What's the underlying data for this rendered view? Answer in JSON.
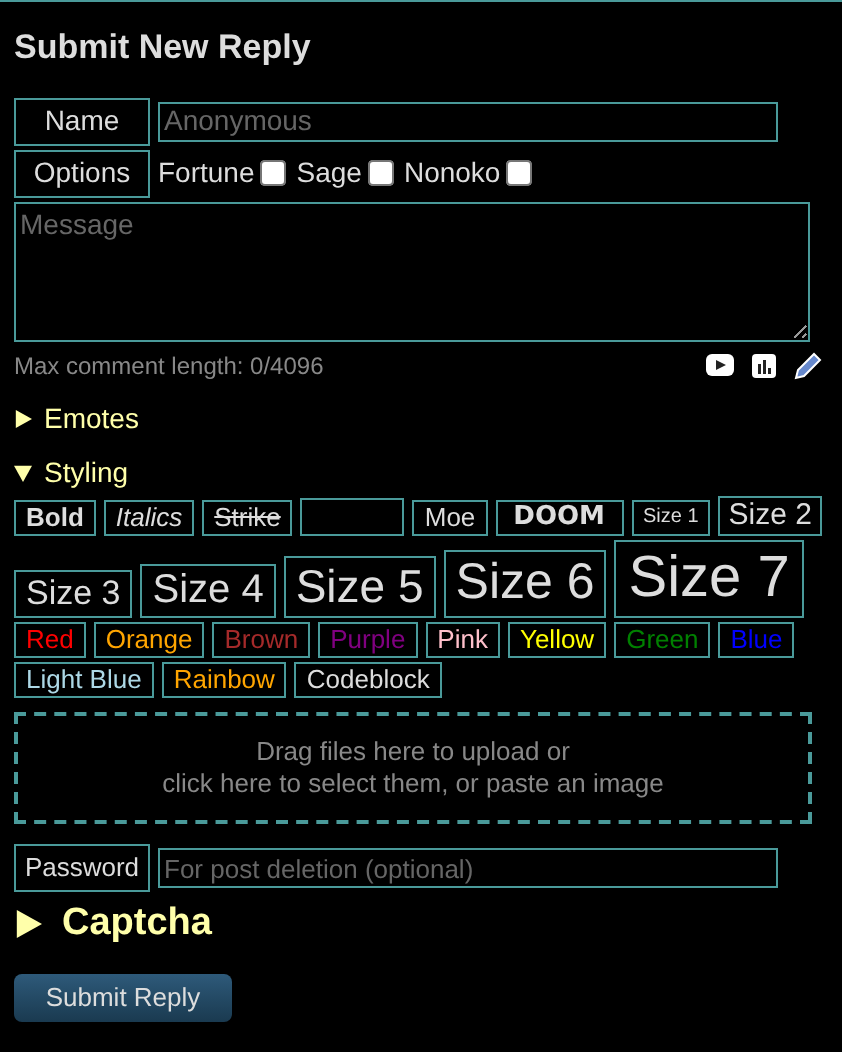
{
  "title": "Submit New Reply",
  "name_field": {
    "label": "Name",
    "placeholder": "Anonymous"
  },
  "options": {
    "label": "Options",
    "items": [
      {
        "label": "Fortune",
        "checked": false
      },
      {
        "label": "Sage",
        "checked": false
      },
      {
        "label": "Nonoko",
        "checked": false
      }
    ]
  },
  "message": {
    "placeholder": "Message",
    "counter": "Max comment length: 0/4096"
  },
  "emotes": {
    "label": "Emotes",
    "expanded": false
  },
  "styling": {
    "label": "Styling",
    "expanded": true,
    "buttons": [
      {
        "kind": "bold",
        "label": "Bold"
      },
      {
        "kind": "italic",
        "label": "Italics"
      },
      {
        "kind": "strike",
        "label": "Strike"
      },
      {
        "kind": "spoiler"
      },
      {
        "kind": "moe",
        "label": "Moe"
      },
      {
        "kind": "doom",
        "label": "DOOM"
      },
      {
        "kind": "size1",
        "label": "Size 1"
      },
      {
        "kind": "size2",
        "label": "Size 2"
      },
      {
        "kind": "size3",
        "label": "Size 3"
      },
      {
        "kind": "size4",
        "label": "Size 4"
      },
      {
        "kind": "size5",
        "label": "Size 5"
      },
      {
        "kind": "size6",
        "label": "Size 6"
      },
      {
        "kind": "size7",
        "label": "Size 7"
      },
      {
        "kind": "color",
        "label": "Red",
        "color": "#ff0000"
      },
      {
        "kind": "color",
        "label": "Orange",
        "color": "#ffa500"
      },
      {
        "kind": "color",
        "label": "Brown",
        "color": "#a52a2a"
      },
      {
        "kind": "color",
        "label": "Purple",
        "color": "#800080"
      },
      {
        "kind": "color",
        "label": "Pink",
        "color": "#ffc0cb"
      },
      {
        "kind": "color",
        "label": "Yellow",
        "color": "#ffff00"
      },
      {
        "kind": "color",
        "label": "Green",
        "color": "#008000"
      },
      {
        "kind": "color",
        "label": "Blue",
        "color": "#0000ff"
      },
      {
        "kind": "color",
        "label": "Light Blue",
        "color": "#add8e6"
      },
      {
        "kind": "rainbow",
        "label": "Rainbow"
      },
      {
        "kind": "code",
        "label": "Codeblock"
      }
    ]
  },
  "upload": {
    "lines": [
      "Drag files here to upload or",
      "click here to select them, or paste an image"
    ]
  },
  "password": {
    "label": "Password",
    "placeholder": "For post deletion (optional)"
  },
  "captcha": {
    "label": "Captcha",
    "expanded": false
  },
  "submit": "Submit Reply"
}
